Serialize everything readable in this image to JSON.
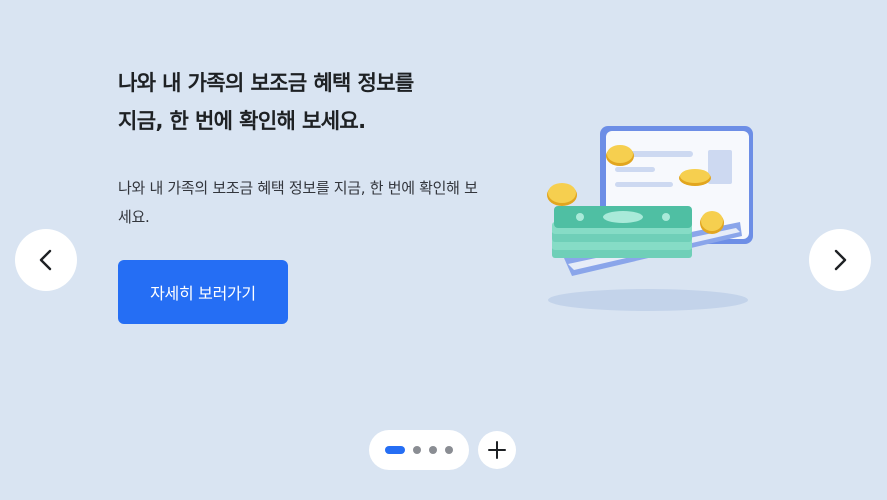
{
  "slide": {
    "title_line1": "나와 내 가족의 보조금 혜택 정보를",
    "title_line2": "지금, 한 번에 확인해 보세요.",
    "description": "나와 내 가족의 보조금 혜택 정보를 지금, 한 번에 확인해 보세요.",
    "cta_label": "자세히 보러가기"
  },
  "navigation": {
    "prev_icon": "chevron-left-icon",
    "next_icon": "chevron-right-icon"
  },
  "pagination": {
    "total": 4,
    "current": 1,
    "add_icon": "plus-icon"
  },
  "illustration": {
    "subject": "laptop-money-coins-illustration"
  },
  "colors": {
    "background": "#d9e4f2",
    "accent": "#256ef4",
    "dot_inactive": "#8a8d93",
    "money_green": "#7dd8c0",
    "coin_gold": "#f2c13a"
  }
}
